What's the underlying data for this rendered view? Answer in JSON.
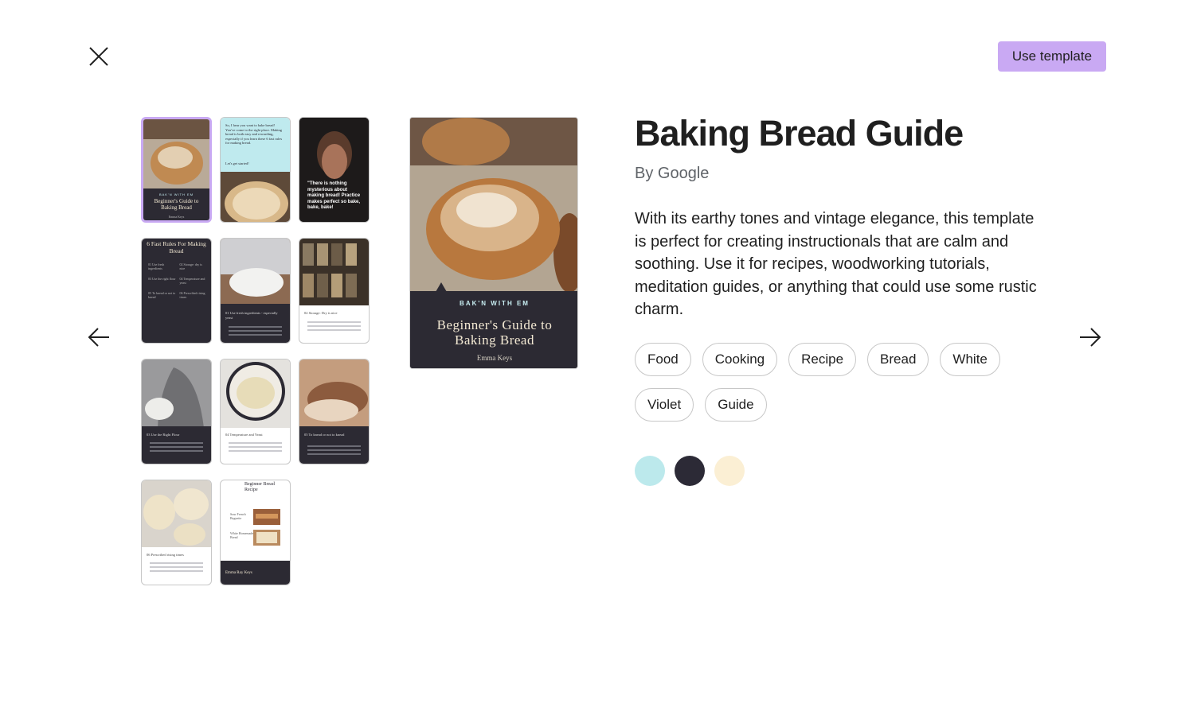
{
  "header": {
    "close_icon": "close-icon",
    "use_template_label": "Use template",
    "accent_color": "#c9a9f3"
  },
  "navigation": {
    "prev_icon": "arrow-left-icon",
    "next_icon": "arrow-right-icon"
  },
  "thumbnails": {
    "t1": {
      "kicker": "BAK'N WITH EM",
      "title": "Beginner's Guide to Baking Bread",
      "author": "Emma Keys"
    },
    "t2": {
      "text": "So, I hear you want to bake bread! You've come to the right place. Making bread is both easy and rewarding, especially if you learn these 6 fast rules for making bread.",
      "cta": "Let's get started!"
    },
    "t3": {
      "quote": "\"There is nothing mysterious about making bread! Practice makes perfect so bake, bake, bake!"
    },
    "t4": {
      "title": "6 Fast Rules For Making Bread",
      "rules": [
        {
          "num": "01",
          "label": "Use fresh ingredients"
        },
        {
          "num": "02",
          "label": "Storage: dry is nice"
        },
        {
          "num": "03",
          "label": "Use the right flour"
        },
        {
          "num": "04",
          "label": "Temperature and yeast"
        },
        {
          "num": "05",
          "label": "To knead or not to knead"
        },
        {
          "num": "06",
          "label": "Prescribed rising times"
        }
      ]
    },
    "t5": {
      "heading": "01  Use fresh ingredients - especially yeast"
    },
    "t6": {
      "heading": "02  Storage: Dry is nice"
    },
    "t7": {
      "heading": "03  Use the Right Flour"
    },
    "t8": {
      "heading": "04  Temperature and Yeast"
    },
    "t9": {
      "heading": "05  To knead or not to knead"
    },
    "t10": {
      "heading": "06  Prescribed rising times"
    },
    "t11": {
      "title": "Beginner Bread Recipe",
      "item1": "Sour French Baguette",
      "item2": "White Homemade Bread",
      "author": "Emma Ray Keys"
    }
  },
  "preview": {
    "kicker": "BAK'N WITH EM",
    "title": "Beginner's Guide to Baking Bread",
    "author": "Emma Keys"
  },
  "info": {
    "title": "Baking Bread Guide",
    "byline": "By Google",
    "description": "With its earthy tones and vintage elegance, this template is perfect for creating instructionals that are calm and soothing. Use it for recipes, woodworking tutorials, meditation guides, or anything that could use some rustic charm.",
    "tags": [
      "Food",
      "Cooking",
      "Recipe",
      "Bread",
      "White",
      "Violet",
      "Guide"
    ],
    "palette": [
      "#bce9ec",
      "#2c2a36",
      "#fbefd4"
    ]
  }
}
